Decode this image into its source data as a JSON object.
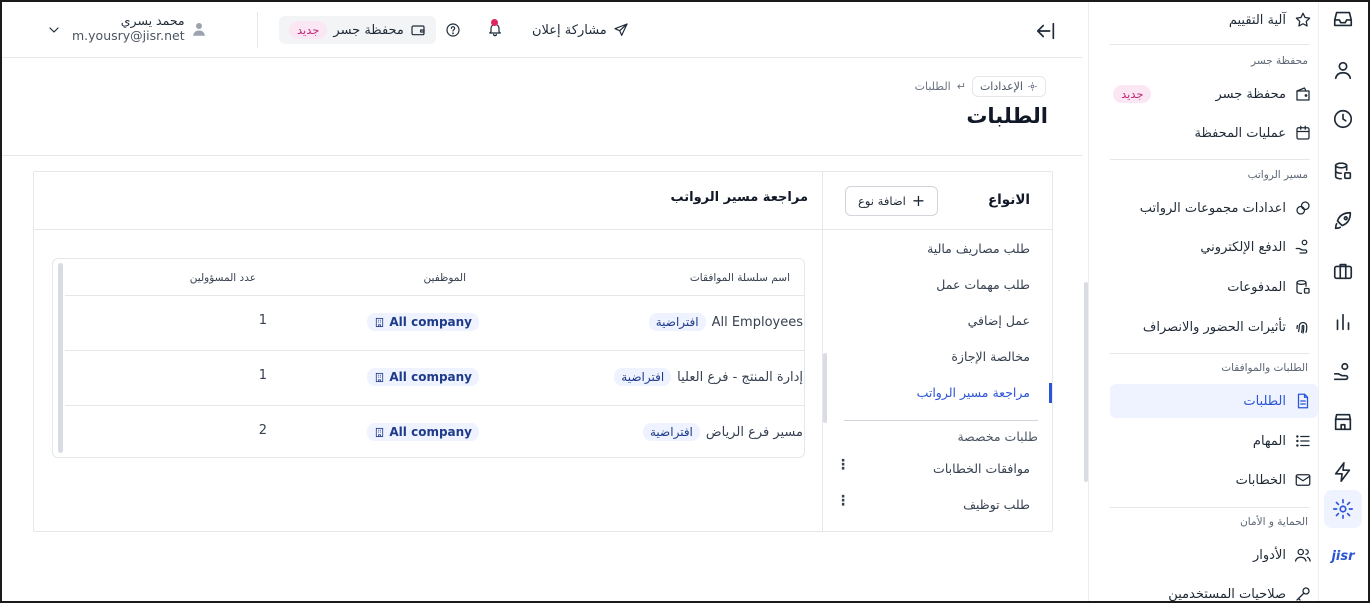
{
  "topbar": {
    "user_name": "محمد يسري",
    "user_email": "m.yousry@jisr.net",
    "wallet_label": "محفظة جسر",
    "wallet_badge": "جديد",
    "share_label": "مشاركة إعلان"
  },
  "sidebar": {
    "top_item": "آلية التقييم",
    "sections": {
      "wallet": "محفظة جسر",
      "payroll": "مسير الرواتب",
      "requests": "الطلبات والموافقات",
      "security": "الحماية و الأمان"
    },
    "wallet_items": [
      {
        "label": "محفظة جسر",
        "badge": "جديد"
      },
      {
        "label": "عمليات المحفظة"
      }
    ],
    "payroll_items": [
      {
        "label": "اعدادات مجموعات الرواتب"
      },
      {
        "label": "الدفع الإلكتروني"
      },
      {
        "label": "المدفوعات"
      },
      {
        "label": "تأثيرات الحضور والانصراف"
      }
    ],
    "requests_items": [
      {
        "label": "الطلبات"
      },
      {
        "label": "المهام"
      },
      {
        "label": "الخطابات"
      }
    ],
    "security_items": [
      {
        "label": "الأدوار"
      },
      {
        "label": "صلاحيات المستخدمين"
      }
    ]
  },
  "rail": {
    "logo": "jisr"
  },
  "breadcrumb": {
    "root": "الإعدادات",
    "current": "الطلبات"
  },
  "page_title": "الطلبات",
  "types_panel": {
    "title": "الانواع",
    "add_button": "اضافة نوع",
    "items": [
      "طلب مصاريف مالية",
      "طلب مهمات عمل",
      "عمل إضافي",
      "مخالصة الإجازة",
      "مراجعة مسير الرواتب"
    ],
    "custom_section": "طلبات مخصصة",
    "custom_items": [
      "موافقات الخطابات",
      "طلب توظيف"
    ]
  },
  "detail": {
    "title": "مراجعة مسير الرواتب",
    "columns": [
      "اسم سلسلة الموافقات",
      "الموظفين",
      "عدد المسؤولين"
    ],
    "rows": [
      {
        "chain": "All Employees",
        "tag": "افتراضية",
        "employees": "All company",
        "count": "1"
      },
      {
        "chain": "إدارة المنتج - فرع العليا",
        "tag": "افتراضية",
        "employees": "All company",
        "count": "1"
      },
      {
        "chain": "مسير فرع الرياض",
        "tag": "افتراضية",
        "employees": "All company",
        "count": "2"
      }
    ]
  }
}
